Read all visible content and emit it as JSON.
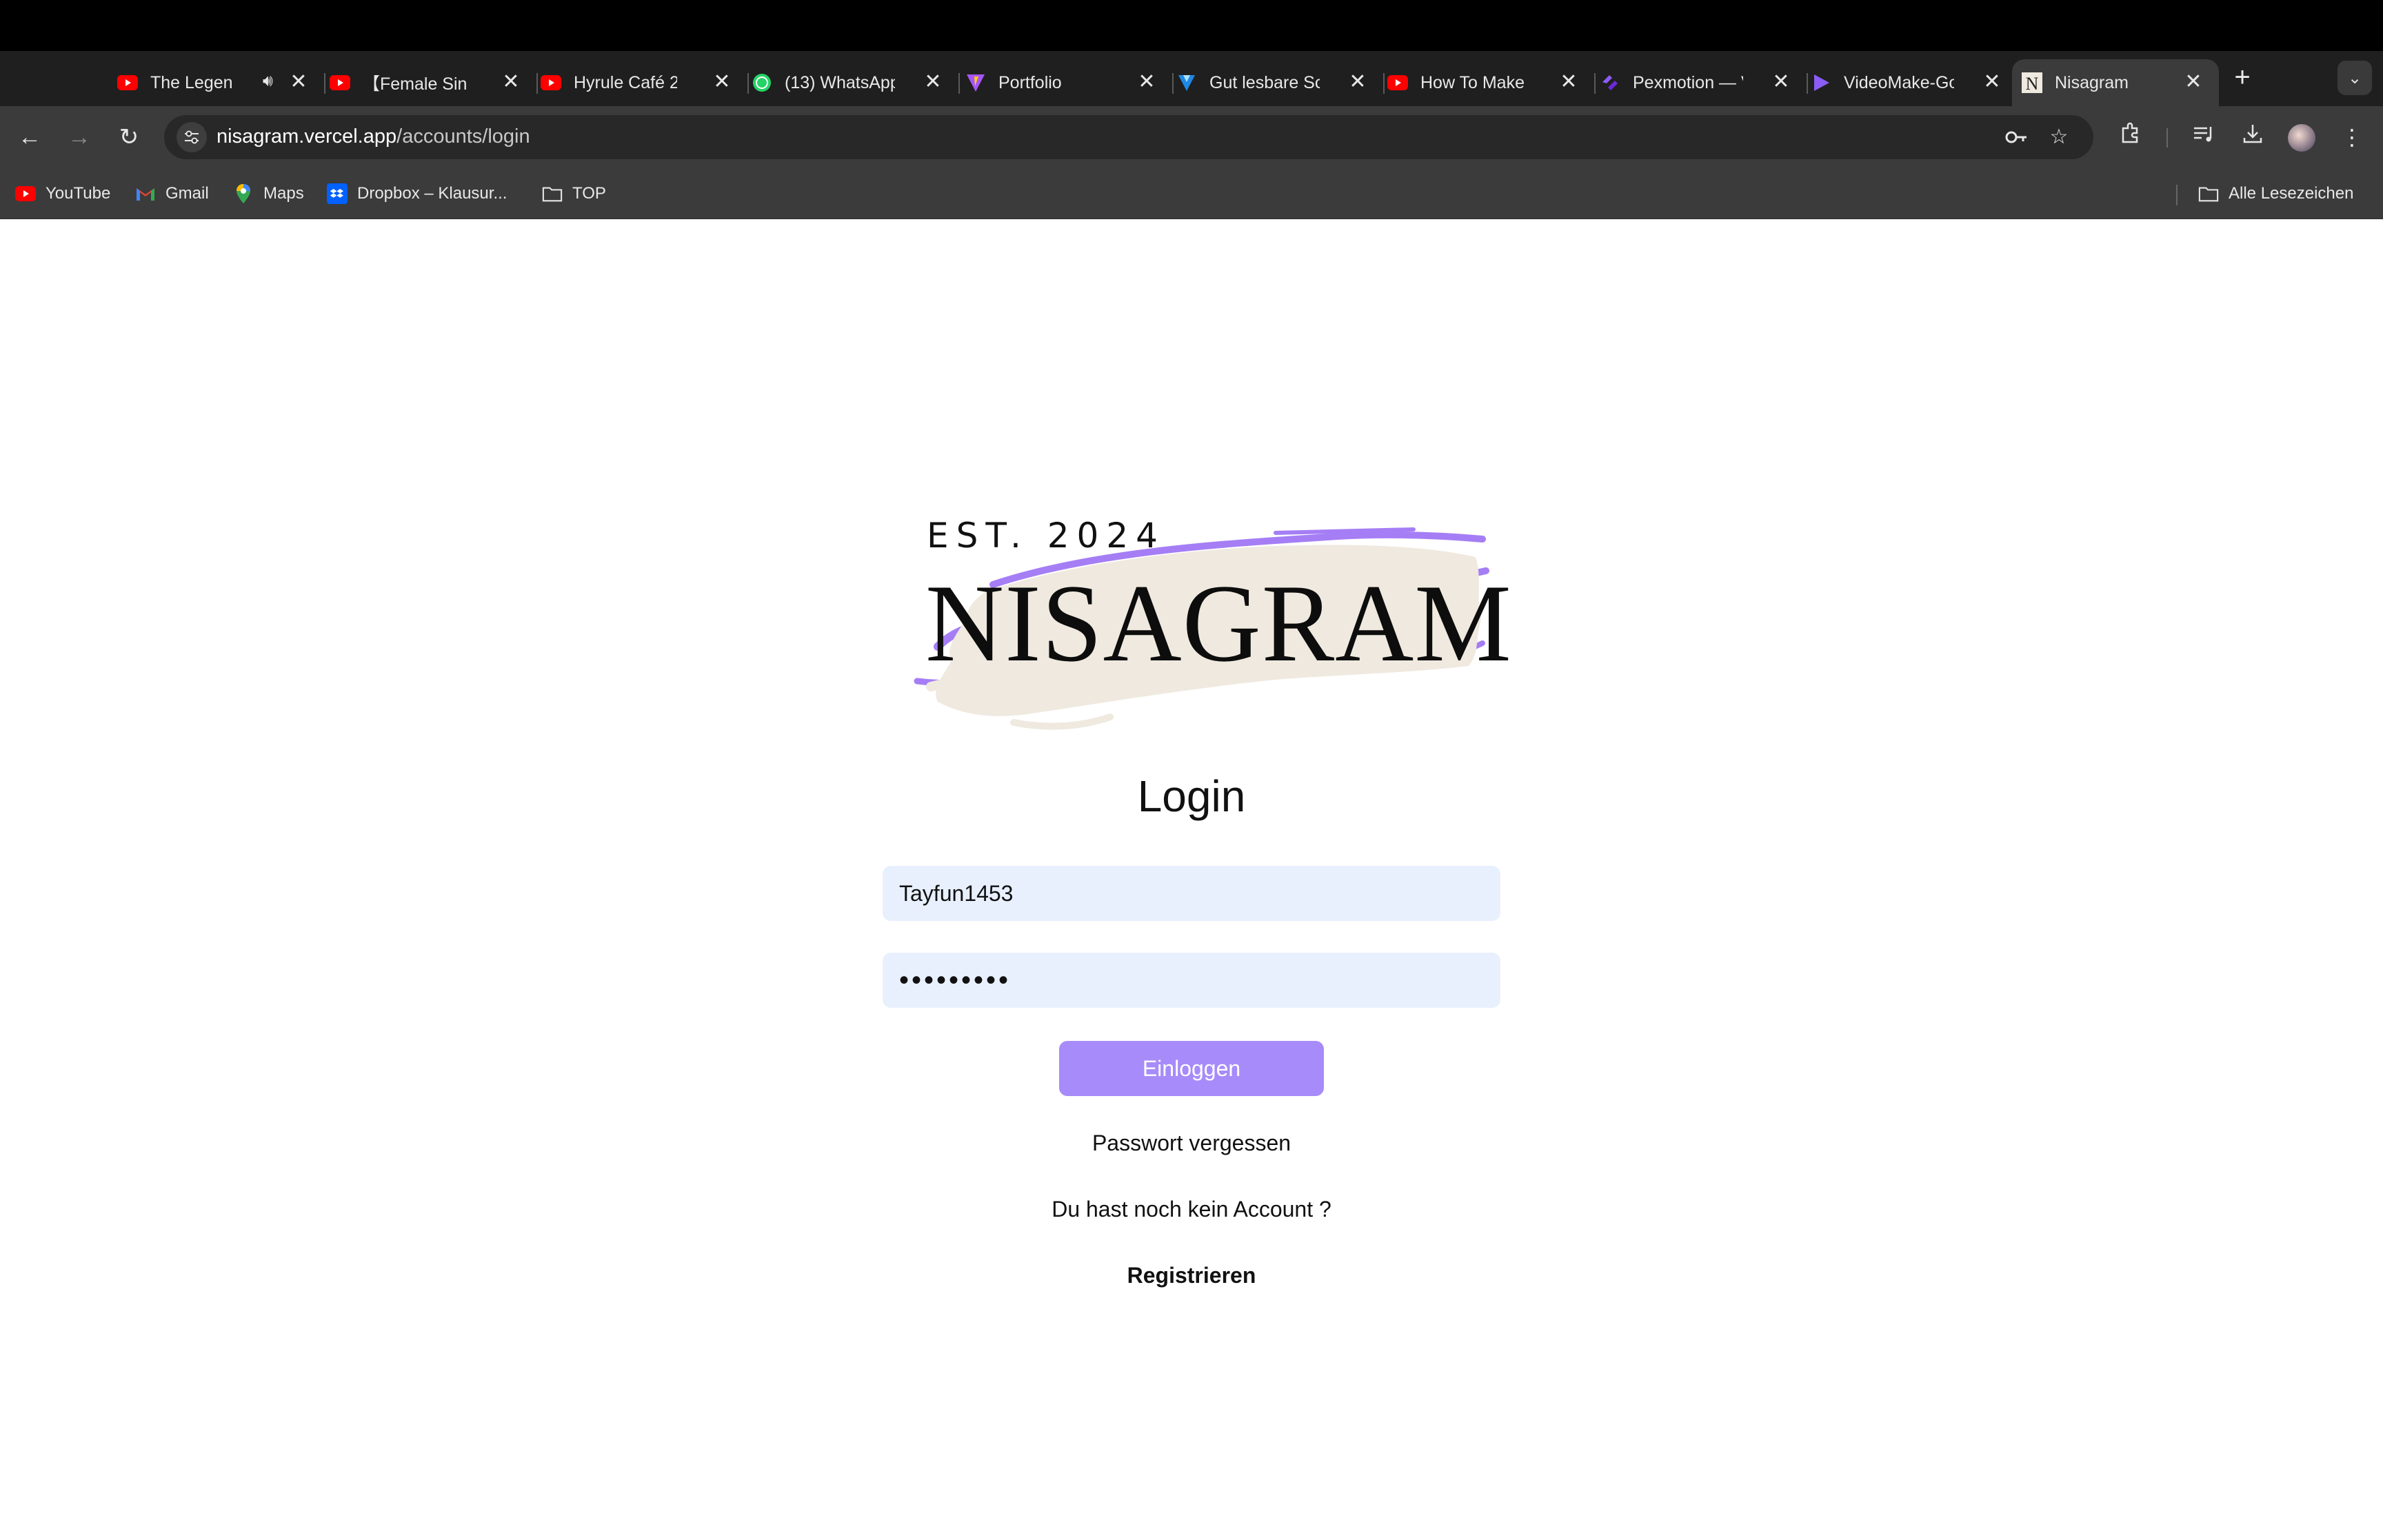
{
  "browser": {
    "tabs": [
      {
        "title": "The Legend of Zelda",
        "favicon": "youtube-icon",
        "audio": true
      },
      {
        "title": "【Female Singer",
        "favicon": "youtube-icon",
        "audio": false
      },
      {
        "title": "Hyrule Café 2",
        "favicon": "youtube-icon",
        "audio": false
      },
      {
        "title": "(13) WhatsApp",
        "favicon": "whatsapp-icon",
        "audio": false
      },
      {
        "title": "Portfolio",
        "favicon": "vite-icon",
        "audio": false
      },
      {
        "title": "Gut lesbare Schriften",
        "favicon": "vuetify-icon",
        "audio": false
      },
      {
        "title": "How To Make It",
        "favicon": "youtube-icon",
        "audio": false
      },
      {
        "title": "Pexmotion — V",
        "favicon": "pexmotion-icon",
        "audio": false
      },
      {
        "title": "VideoMake-Go",
        "favicon": "play-icon",
        "audio": false
      },
      {
        "title": "Nisagram",
        "favicon": "nisagram-icon",
        "audio": false,
        "active": true
      }
    ],
    "url": {
      "host": "nisagram.vercel.app",
      "path": "/accounts/login"
    },
    "bookmarks": [
      {
        "label": "YouTube",
        "icon": "youtube-icon"
      },
      {
        "label": "Gmail",
        "icon": "gmail-icon"
      },
      {
        "label": "Maps",
        "icon": "maps-icon"
      },
      {
        "label": "Dropbox – Klausur...",
        "icon": "dropbox-icon"
      },
      {
        "label": "TOP",
        "icon": "folder-icon"
      }
    ],
    "all_bookmarks_label": "Alle Lesezeichen"
  },
  "logo": {
    "established": "EST. 2024",
    "name": "NISAGRAM",
    "brush_color": "#efe9df",
    "accent_color": "#a57ef5"
  },
  "login": {
    "title": "Login",
    "username_value": "Tayfun1453",
    "password_value": "•••••••••",
    "submit_label": "Einloggen",
    "forgot_password": "Passwort vergessen",
    "no_account": "Du hast noch kein Account ?",
    "register": "Registrieren"
  },
  "colors": {
    "button": "#a78bfa",
    "input_bg": "#e8f0fe"
  }
}
